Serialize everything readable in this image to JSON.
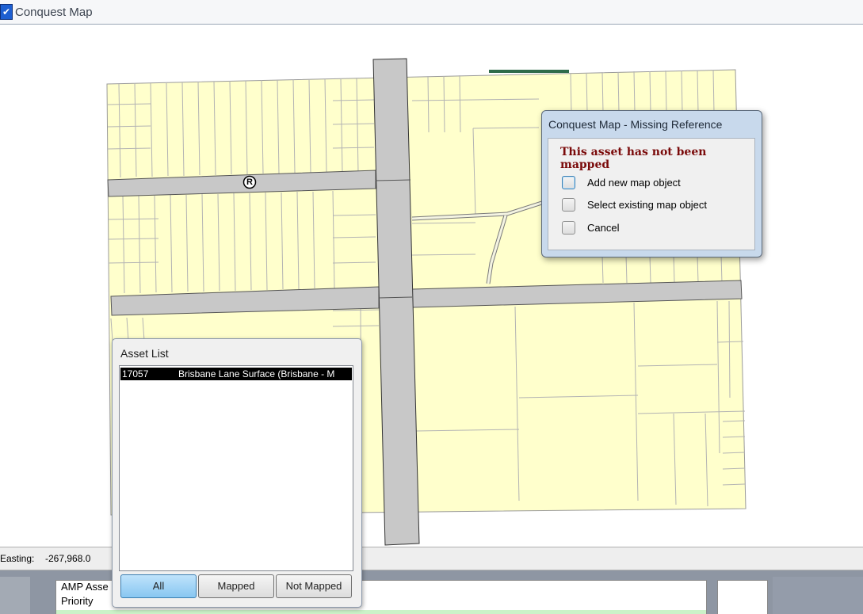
{
  "window": {
    "title": "Conquest Map",
    "icon": "app-check-icon"
  },
  "status_bar": {
    "easting_label": "Easting:",
    "easting_value": "-267,968.0"
  },
  "asset_list": {
    "title": "Asset List",
    "rows": [
      {
        "id": "17057",
        "description": "Brisbane Lane Surface (Brisbane - M"
      }
    ],
    "filters": [
      "All",
      "Mapped",
      "Not Mapped"
    ],
    "active_filter": "All"
  },
  "dialog": {
    "title": "Conquest Map - Missing Reference",
    "message": "This asset has not been mapped",
    "options": [
      "Add new map object",
      "Select existing map object",
      "Cancel"
    ]
  },
  "bottom_panel": {
    "rows": [
      "AMP Asse",
      "Priority"
    ]
  },
  "map": {
    "road_symbol": "R",
    "parcel_color": "#ffffcc",
    "road_color": "#c8c8c8"
  }
}
